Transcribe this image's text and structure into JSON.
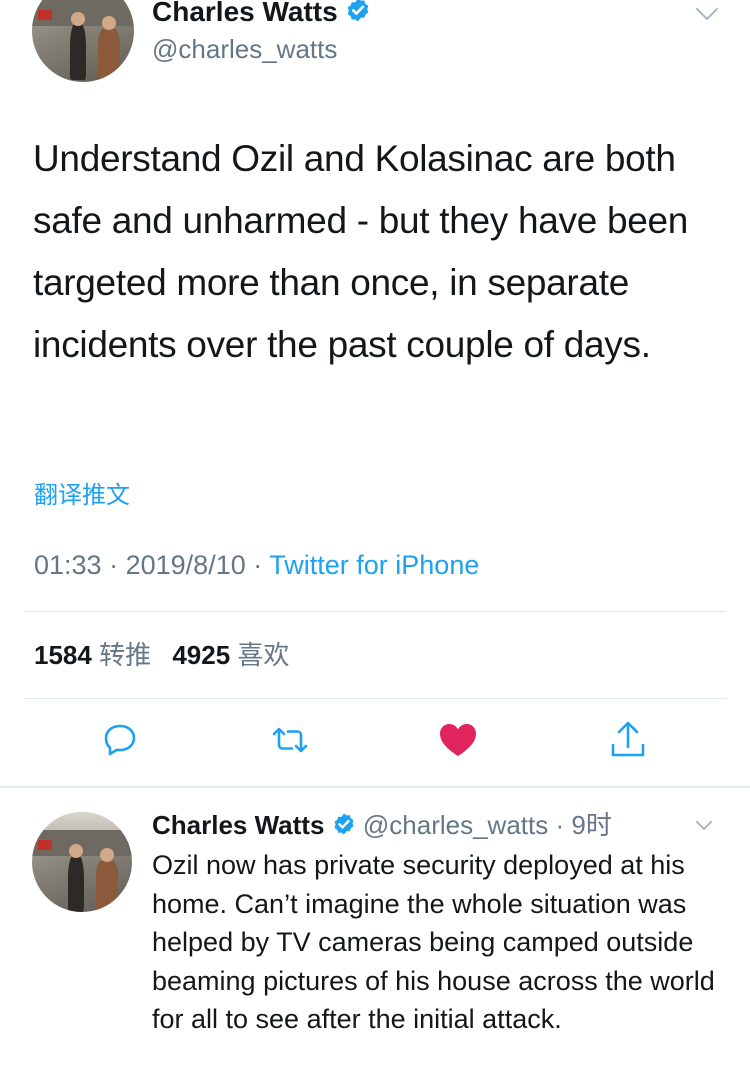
{
  "main_tweet": {
    "author_name": "Charles Watts",
    "handle": "@charles_watts",
    "text": "Understand Ozil and Kolasinac are both safe and unharmed - but they have been targeted more than once, in separate incidents over the past couple of days.",
    "translate_label": "翻译推文",
    "time": "01:33",
    "date": "2019/8/10",
    "separator": "·",
    "source": "Twitter for iPhone",
    "retweet_count": "1584",
    "retweet_label": "转推",
    "like_count": "4925",
    "like_label": "喜欢",
    "liked": true
  },
  "reply_tweet": {
    "author_name": "Charles Watts",
    "handle": "@charles_watts",
    "separator": "·",
    "time_ago": "9时",
    "text": "Ozil now has private security deployed at his home. Can’t imagine the whole situation was helped by TV cameras being camped outside beaming pictures of his house across the world for all to see after the initial attack."
  },
  "icons": {
    "verified": "verified-badge-icon",
    "menu": "chevron-down-icon",
    "reply": "reply-icon",
    "retweet": "retweet-icon",
    "like": "heart-icon",
    "share": "share-icon"
  },
  "colors": {
    "accent": "#1da1f2",
    "like": "#e0245e",
    "secondary_text": "#657786",
    "divider": "#e1e8ed"
  }
}
